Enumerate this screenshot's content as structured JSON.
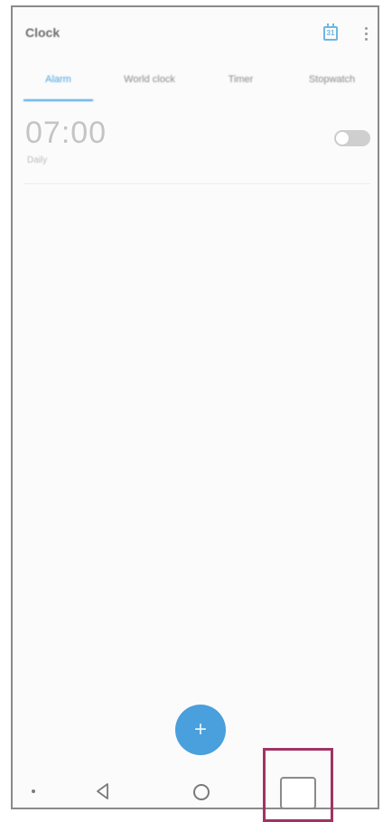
{
  "app": {
    "title": "Clock",
    "calendar_icon_label": "31"
  },
  "tabs": [
    {
      "label": "Alarm",
      "active": true
    },
    {
      "label": "World clock",
      "active": false
    },
    {
      "label": "Timer",
      "active": false
    },
    {
      "label": "Stopwatch",
      "active": false
    }
  ],
  "alarm": {
    "time": "07:00",
    "subtitle": "Daily",
    "enabled": false
  },
  "fab": {
    "label": "+"
  },
  "colors": {
    "accent": "#4aa3df",
    "highlight": "#a03464"
  },
  "icons": {
    "calendar": "calendar-icon",
    "overflow": "more-vertical-icon",
    "back": "back-triangle-icon",
    "home": "home-circle-icon",
    "recents": "recents-square-icon"
  }
}
